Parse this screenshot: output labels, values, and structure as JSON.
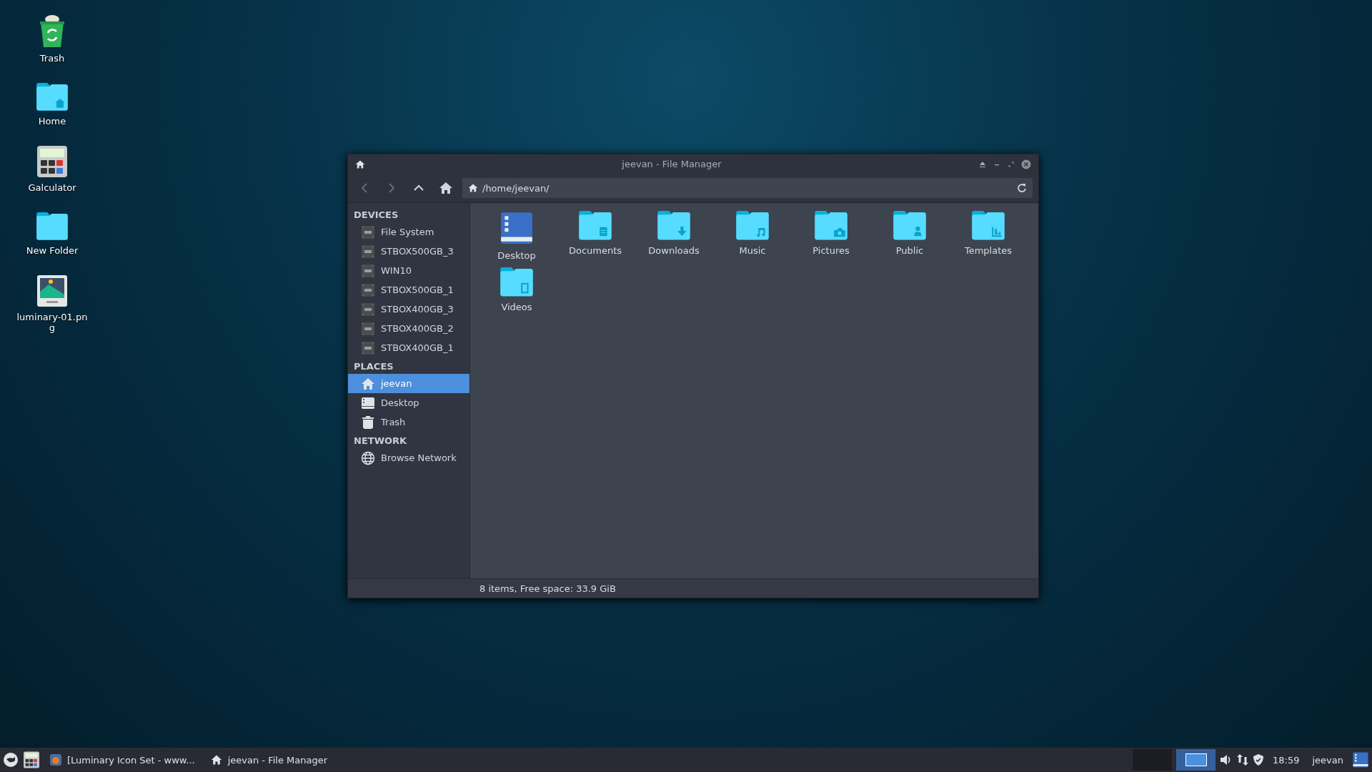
{
  "desktop_icons": [
    {
      "kind": "trash",
      "label": "Trash"
    },
    {
      "kind": "home",
      "label": "Home"
    },
    {
      "kind": "calculator",
      "label": "Galculator"
    },
    {
      "kind": "folder",
      "label": "New Folder"
    },
    {
      "kind": "image",
      "label": "luminary-01.png"
    }
  ],
  "window": {
    "title": "jeevan - File Manager",
    "location": "/home/jeevan/",
    "sidebar": [
      {
        "heading": "DEVICES",
        "items": [
          {
            "kind": "drive",
            "label": "File System",
            "selected": false
          },
          {
            "kind": "drive",
            "label": "STBOX500GB_3",
            "selected": false
          },
          {
            "kind": "drive",
            "label": "WIN10",
            "selected": false
          },
          {
            "kind": "drive",
            "label": "STBOX500GB_1",
            "selected": false
          },
          {
            "kind": "drive",
            "label": "STBOX400GB_3",
            "selected": false
          },
          {
            "kind": "drive",
            "label": "STBOX400GB_2",
            "selected": false
          },
          {
            "kind": "drive",
            "label": "STBOX400GB_1",
            "selected": false
          }
        ]
      },
      {
        "heading": "PLACES",
        "items": [
          {
            "kind": "home",
            "label": "jeevan",
            "selected": true
          },
          {
            "kind": "desktop",
            "label": "Desktop",
            "selected": false
          },
          {
            "kind": "trash",
            "label": "Trash",
            "selected": false
          }
        ]
      },
      {
        "heading": "NETWORK",
        "items": [
          {
            "kind": "network",
            "label": "Browse Network",
            "selected": false
          }
        ]
      }
    ],
    "files": [
      {
        "kind": "desktop",
        "label": "Desktop"
      },
      {
        "kind": "documents",
        "label": "Documents"
      },
      {
        "kind": "downloads",
        "label": "Downloads"
      },
      {
        "kind": "music",
        "label": "Music"
      },
      {
        "kind": "pictures",
        "label": "Pictures"
      },
      {
        "kind": "public",
        "label": "Public"
      },
      {
        "kind": "templates",
        "label": "Templates"
      },
      {
        "kind": "videos",
        "label": "Videos"
      }
    ],
    "status_bar": "8 items, Free space: 33.9 GiB"
  },
  "taskbar": {
    "tasks": [
      {
        "kind": "browser",
        "label": "[Luminary Icon Set - www..."
      },
      {
        "kind": "files",
        "label": "jeevan - File Manager"
      }
    ],
    "workspaces": [
      {
        "selected": false
      },
      {
        "selected": true
      }
    ],
    "clock": "18:59",
    "user": "jeevan"
  }
}
